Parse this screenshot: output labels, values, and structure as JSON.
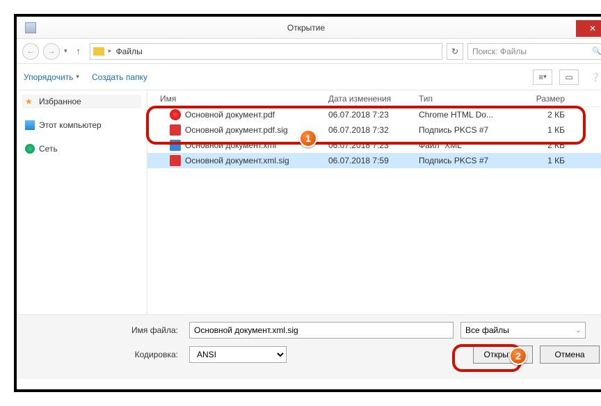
{
  "window": {
    "title": "Открытие"
  },
  "nav": {
    "path_item": "Файлы",
    "search_placeholder": "Поиск: Файлы"
  },
  "toolbar": {
    "organize": "Упорядочить",
    "new_folder": "Создать папку"
  },
  "sidebar": {
    "favorites": "Избранное",
    "computer": "Этот компьютер",
    "network": "Сеть"
  },
  "columns": {
    "name": "Имя",
    "date": "Дата изменения",
    "type": "Тип",
    "size": "Размер"
  },
  "files": [
    {
      "icon": "pdf",
      "name": "Основной документ.pdf",
      "date": "06.07.2018 7:23",
      "type": "Chrome HTML Do...",
      "size": "2 КБ",
      "selected": false
    },
    {
      "icon": "sig",
      "name": "Основной документ.pdf.sig",
      "date": "06.07.2018 7:32",
      "type": "Подпись PKCS #7",
      "size": "1 КБ",
      "selected": false
    },
    {
      "icon": "xml",
      "name": "Основной документ.xml",
      "date": "06.07.2018 7:23",
      "type": "Файл \"XML\"",
      "size": "2 КБ",
      "selected": false
    },
    {
      "icon": "sig",
      "name": "Основной документ.xml.sig",
      "date": "06.07.2018 7:59",
      "type": "Подпись PKCS #7",
      "size": "1 КБ",
      "selected": true
    }
  ],
  "form": {
    "filename_label": "Имя файла:",
    "filename_value": "Основной документ.xml.sig",
    "encoding_label": "Кодировка:",
    "encoding_value": "ANSI",
    "filter_value": "Все файлы",
    "open": "Открыть",
    "cancel": "Отмена"
  },
  "badges": {
    "one": "1",
    "two": "2"
  }
}
